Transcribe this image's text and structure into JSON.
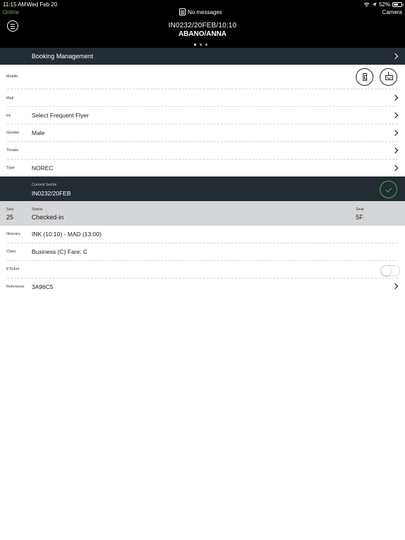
{
  "status_bar": {
    "time": "11:15 AM",
    "date": "Wed Feb 20",
    "battery": "52%",
    "connection": "Online",
    "camera": "Camera",
    "messages": "No messages"
  },
  "header": {
    "flight": "IN0232/20FEB/10:10",
    "passenger": "ABANO/ANNA",
    "page_dots": 3,
    "active_dot": 0
  },
  "booking_management": {
    "label": "Booking Management"
  },
  "contact_rows": [
    {
      "label": "Mobile",
      "value": ""
    },
    {
      "label": "Mail",
      "value": ""
    },
    {
      "label": "FF",
      "value": "Select Frequent Flyer"
    },
    {
      "label": "Gender",
      "value": "Male"
    },
    {
      "label": "Timatic",
      "value": ""
    },
    {
      "label": "Type",
      "value": "NOREC"
    }
  ],
  "current_sector": {
    "label": "Current Sector",
    "value": "IN0232/20FEB"
  },
  "segment_status": {
    "seq_label": "Seq",
    "seq_value": "25",
    "status_label": "Status",
    "status_value": "Checked-in",
    "seat_label": "Seat",
    "seat_value": "5F"
  },
  "segment_rows": [
    {
      "label": "Itinerary",
      "value": "INK (10:10) - MAD (13:00)"
    },
    {
      "label": "Class",
      "value": "Business (C) Fare: C"
    },
    {
      "label": "ETicket",
      "value": ""
    },
    {
      "label": "Reference",
      "value": "3A96C5"
    }
  ],
  "eticket_toggle": {
    "on": false
  },
  "colors": {
    "header_bg": "#000000",
    "section_bg": "#232b33",
    "status_bg": "#d5d6d8",
    "online": "#6db33f",
    "accept": "#3fb34f"
  },
  "icons": {
    "menu": "menu-icon",
    "mobile_action": "phone-icon",
    "mail_action": "mail-send-icon",
    "accept": "checkmark-icon",
    "disclosure": "chevron-right-icon"
  }
}
